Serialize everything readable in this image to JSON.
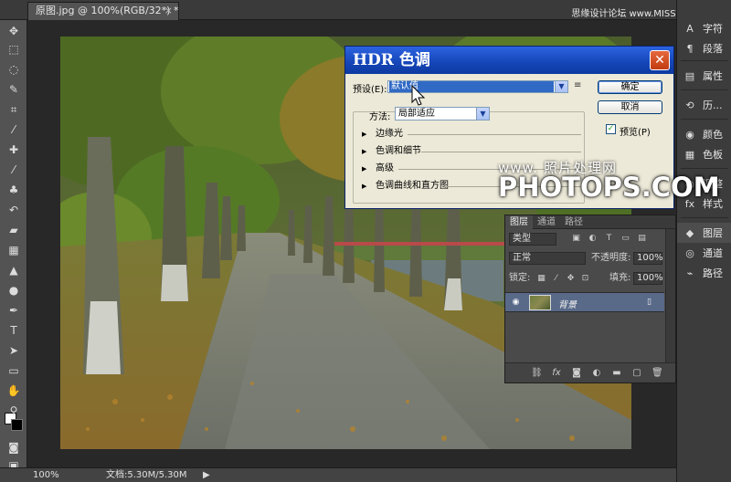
{
  "document": {
    "tab_title": "原图.jpg @ 100%(RGB/32*) *",
    "close_glyph": "×",
    "site_watermark": "思缘设计论坛 www.MISSYUAN.COM"
  },
  "toolbar": {
    "tools": [
      {
        "name": "move-tool",
        "glyph": "✥"
      },
      {
        "name": "marquee-tool",
        "glyph": "⬚"
      },
      {
        "name": "lasso-tool",
        "glyph": "◌"
      },
      {
        "name": "quick-select-tool",
        "glyph": "✎"
      },
      {
        "name": "crop-tool",
        "glyph": "⌗"
      },
      {
        "name": "eyedropper-tool",
        "glyph": "⁄"
      },
      {
        "name": "healing-tool",
        "glyph": "✚"
      },
      {
        "name": "brush-tool",
        "glyph": "⁄"
      },
      {
        "name": "stamp-tool",
        "glyph": "♣"
      },
      {
        "name": "history-brush-tool",
        "glyph": "↶"
      },
      {
        "name": "eraser-tool",
        "glyph": "▰"
      },
      {
        "name": "gradient-tool",
        "glyph": "▦"
      },
      {
        "name": "blur-tool",
        "glyph": "▲"
      },
      {
        "name": "dodge-tool",
        "glyph": "●"
      },
      {
        "name": "pen-tool",
        "glyph": "✒"
      },
      {
        "name": "type-tool",
        "glyph": "T"
      },
      {
        "name": "path-select-tool",
        "glyph": "➤"
      },
      {
        "name": "shape-tool",
        "glyph": "▭"
      },
      {
        "name": "hand-tool",
        "glyph": "✋"
      },
      {
        "name": "zoom-tool",
        "glyph": "⚲"
      }
    ]
  },
  "dock": {
    "items": [
      {
        "label": "字符",
        "icon": "A"
      },
      {
        "label": "段落",
        "icon": "¶"
      },
      {
        "label": "属性",
        "icon": "▤"
      },
      {
        "label": "历...",
        "icon": "⟲"
      },
      {
        "label": "颜色",
        "icon": "◉"
      },
      {
        "label": "色板",
        "icon": "▦"
      },
      {
        "label": "调整",
        "icon": "◐"
      },
      {
        "label": "样式",
        "icon": "fx"
      },
      {
        "label": "图层",
        "icon": "◆"
      },
      {
        "label": "通道",
        "icon": "◎"
      },
      {
        "label": "路径",
        "icon": "⌁"
      }
    ]
  },
  "status": {
    "zoom": "100%",
    "doc_info": "文档:5.30M/5.30M",
    "arrow": "▶"
  },
  "hdr_dialog": {
    "title": "HDR 色调",
    "close": "✕",
    "preset_label": "预设(E):",
    "preset_value": "默认值",
    "preset_menu_icon": "≡",
    "ok_label": "确定",
    "cancel_label": "取消",
    "preview_label": "预览(P)",
    "preview_checked": "✓",
    "method_label": "方法:",
    "method_value": "局部适应",
    "sections": [
      "边缘光",
      "色调和细节",
      "高级",
      "色调曲线和直方图"
    ]
  },
  "layers_panel": {
    "tabs": [
      "图层",
      "通道",
      "路径"
    ],
    "filter_kind": "类型",
    "blend_mode": "正常",
    "opacity_label": "不透明度:",
    "opacity_value": "100%",
    "lock_label": "锁定:",
    "fill_label": "填充:",
    "fill_value": "100%",
    "layer_name": "背景",
    "bottom_icons": [
      "link-icon",
      "fx-icon",
      "mask-icon",
      "adjustment-icon",
      "group-icon",
      "new-layer-icon",
      "trash-icon"
    ]
  },
  "watermark": {
    "line1": "www.    照片处理网",
    "line2": "PHOTOPS.COM"
  }
}
